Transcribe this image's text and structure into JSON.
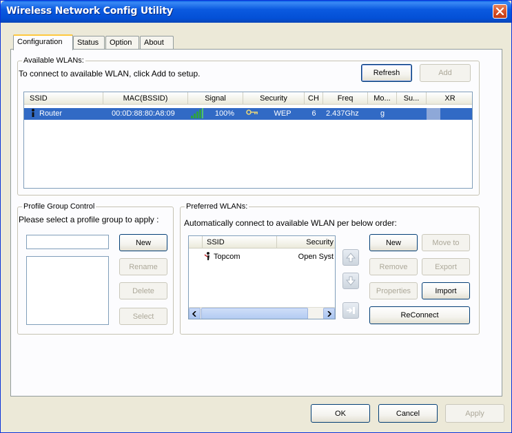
{
  "window": {
    "title": "Wireless Network Config Utility",
    "close_icon": "close-icon"
  },
  "tabs": [
    {
      "label": "Configuration",
      "active": true
    },
    {
      "label": "Status",
      "active": false
    },
    {
      "label": "Option",
      "active": false
    },
    {
      "label": "About",
      "active": false
    }
  ],
  "available_wlans": {
    "group_title": "Available WLANs:",
    "instruction": "To connect to available WLAN, click Add to setup.",
    "refresh_label": "Refresh",
    "add_label": "Add",
    "columns": [
      "SSID",
      "MAC(BSSID)",
      "Signal",
      "Security",
      "CH",
      "Freq",
      "Mo...",
      "Su...",
      "XR"
    ],
    "rows": [
      {
        "ssid": "Router",
        "mac": "00:0D:88:80:A8:09",
        "signal": "100%",
        "security": "WEP",
        "ch": "6",
        "freq": "2.437Ghz",
        "mode": "g",
        "su": "",
        "xr": "",
        "selected": true
      }
    ]
  },
  "profile_group": {
    "group_title": "Profile Group Control",
    "instruction": "Please select a profile group to apply :",
    "input_value": "",
    "new_label": "New",
    "rename_label": "Rename",
    "delete_label": "Delete",
    "select_label": "Select"
  },
  "preferred_wlans": {
    "group_title": "Preferred WLANs:",
    "instruction": "Automatically connect to available WLAN per below order:",
    "columns": [
      "SSID",
      "Security"
    ],
    "rows": [
      {
        "ssid": "Topcom",
        "security": "Open Syst"
      }
    ],
    "new_label": "New",
    "move_to_label": "Move to",
    "remove_label": "Remove",
    "export_label": "Export",
    "properties_label": "Properties",
    "import_label": "Import",
    "reconnect_label": "ReConnect"
  },
  "footer": {
    "ok_label": "OK",
    "cancel_label": "Cancel",
    "apply_label": "Apply"
  },
  "colors": {
    "selection": "#316ac5",
    "title_bar": "#0350d6",
    "dialog_bg": "#ece9d8"
  }
}
